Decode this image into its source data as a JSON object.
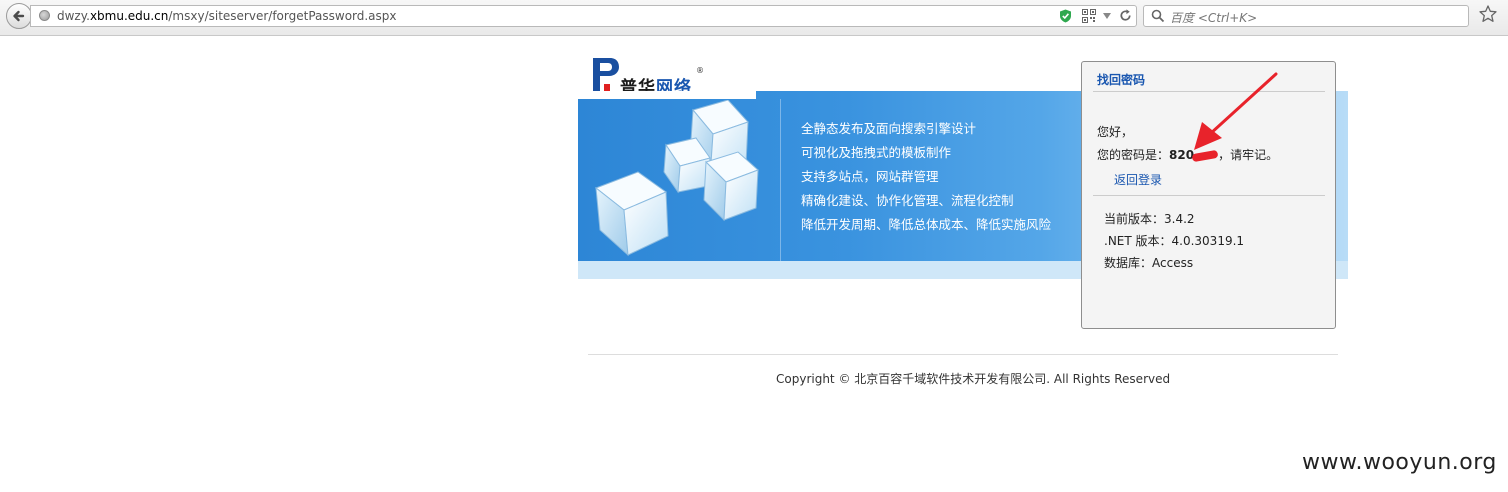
{
  "browser": {
    "url_prefix": "dwzy.",
    "url_host": "xbmu.edu.cn",
    "url_path": "/msxy/siteserver/forgetPassword.aspx",
    "search_placeholder": "百度 <Ctrl+K>"
  },
  "logo": {
    "mark": "P",
    "text_part1": "普华",
    "text_part2": "网络",
    "registered": "®"
  },
  "features": [
    "全静态发布及面向搜索引擎设计",
    "可视化及拖拽式的模板制作",
    "支持多站点，网站群管理",
    "精确化建设、协作化管理、流程化控制",
    "降低开发周期、降低总体成本、降低实施风险"
  ],
  "panel": {
    "title": "找回密码",
    "greeting": "您好，",
    "password_prefix": "您的密码是：",
    "password_visible": "820",
    "password_suffix": "，请牢记。",
    "back_link": "返回登录",
    "version_line": "当前版本：3.4.2",
    "net_line": ".NET 版本：4.0.30319.1",
    "db_line": "数据库：Access"
  },
  "footer": {
    "copyright": "Copyright © 北京百容千域软件技术开发有限公司. All Rights Reserved"
  },
  "watermark": "www.wooyun.org",
  "colors": {
    "link_blue": "#1a57b0",
    "banner_blue": "#2d86d6",
    "annotation_red": "#e8232b"
  }
}
